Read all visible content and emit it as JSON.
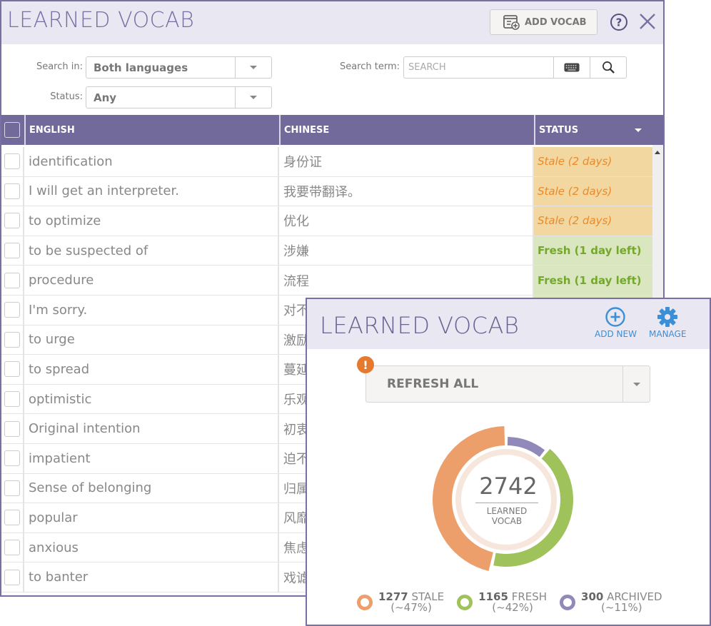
{
  "main_window": {
    "title": "LEARNED VOCAB",
    "add_vocab_label": "ADD VOCAB",
    "filters": {
      "search_in_label": "Search in:",
      "search_in_value": "Both languages",
      "status_label": "Status:",
      "status_value": "Any",
      "search_term_label": "Search term:",
      "search_placeholder": "SEARCH",
      "search_value": ""
    },
    "table": {
      "columns": [
        "ENGLISH",
        "CHINESE",
        "STATUS"
      ],
      "rows": [
        {
          "english": "identification",
          "chinese": "身份证",
          "status": "Stale (2 days)",
          "status_type": "stale"
        },
        {
          "english": "I will get an interpreter.",
          "chinese": "我要带翻译。",
          "status": "Stale (2 days)",
          "status_type": "stale"
        },
        {
          "english": "to optimize",
          "chinese": "优化",
          "status": "Stale (2 days)",
          "status_type": "stale"
        },
        {
          "english": "to be suspected of",
          "chinese": "涉嫌",
          "status": "Fresh (1 day left)",
          "status_type": "fresh"
        },
        {
          "english": "procedure",
          "chinese": "流程",
          "status": "Fresh (1 day left)",
          "status_type": "fresh"
        },
        {
          "english": "I'm sorry.",
          "chinese": "对不",
          "status": "",
          "status_type": "fresh"
        },
        {
          "english": "to urge",
          "chinese": "激励",
          "status": "",
          "status_type": "fresh"
        },
        {
          "english": "to spread",
          "chinese": "蔓延",
          "status": "",
          "status_type": "fresh"
        },
        {
          "english": "optimistic",
          "chinese": "乐观",
          "status": "",
          "status_type": "fresh"
        },
        {
          "english": "Original intention",
          "chinese": "初衷",
          "status": "",
          "status_type": "fresh"
        },
        {
          "english": "impatient",
          "chinese": "迫不",
          "status": "",
          "status_type": "fresh"
        },
        {
          "english": "Sense of belonging",
          "chinese": "归属",
          "status": "",
          "status_type": "fresh"
        },
        {
          "english": "popular",
          "chinese": "风靡",
          "status": "",
          "status_type": "fresh"
        },
        {
          "english": "anxious",
          "chinese": "焦虑",
          "status": "",
          "status_type": "fresh"
        },
        {
          "english": "to banter",
          "chinese": "戏谑",
          "status": "",
          "status_type": "fresh"
        }
      ]
    }
  },
  "panel": {
    "title": "LEARNED VOCAB",
    "add_new_label": "ADD NEW",
    "manage_label": "MANAGE",
    "refresh_label": "REFRESH ALL",
    "alert_glyph": "!",
    "total": "2742",
    "total_label_line1": "LEARNED",
    "total_label_line2": "VOCAB",
    "legend": [
      {
        "count": "1277",
        "label": "STALE",
        "pct": "(~47%)",
        "color": "#ec9f6a"
      },
      {
        "count": "1165",
        "label": "FRESH",
        "pct": "(~42%)",
        "color": "#9fc35a"
      },
      {
        "count": "300",
        "label": "ARCHIVED",
        "pct": "(~11%)",
        "color": "#9189ba"
      }
    ]
  },
  "colors": {
    "brand_purple": "#736a9c",
    "stale_bg": "#f2d7a0",
    "stale_text": "#ec8a28",
    "fresh_bg": "#d9e6bf",
    "fresh_text": "#74a82c",
    "link_blue": "#3b8fd6"
  },
  "chart_data": {
    "type": "pie",
    "title": "2742 LEARNED VOCAB",
    "categories": [
      "STALE",
      "FRESH",
      "ARCHIVED"
    ],
    "values": [
      1277,
      1165,
      300
    ],
    "percent_labels": [
      "~47%",
      "~42%",
      "~11%"
    ],
    "colors": [
      "#ec9f6a",
      "#9fc35a",
      "#9189ba"
    ],
    "legend": "bottom"
  }
}
